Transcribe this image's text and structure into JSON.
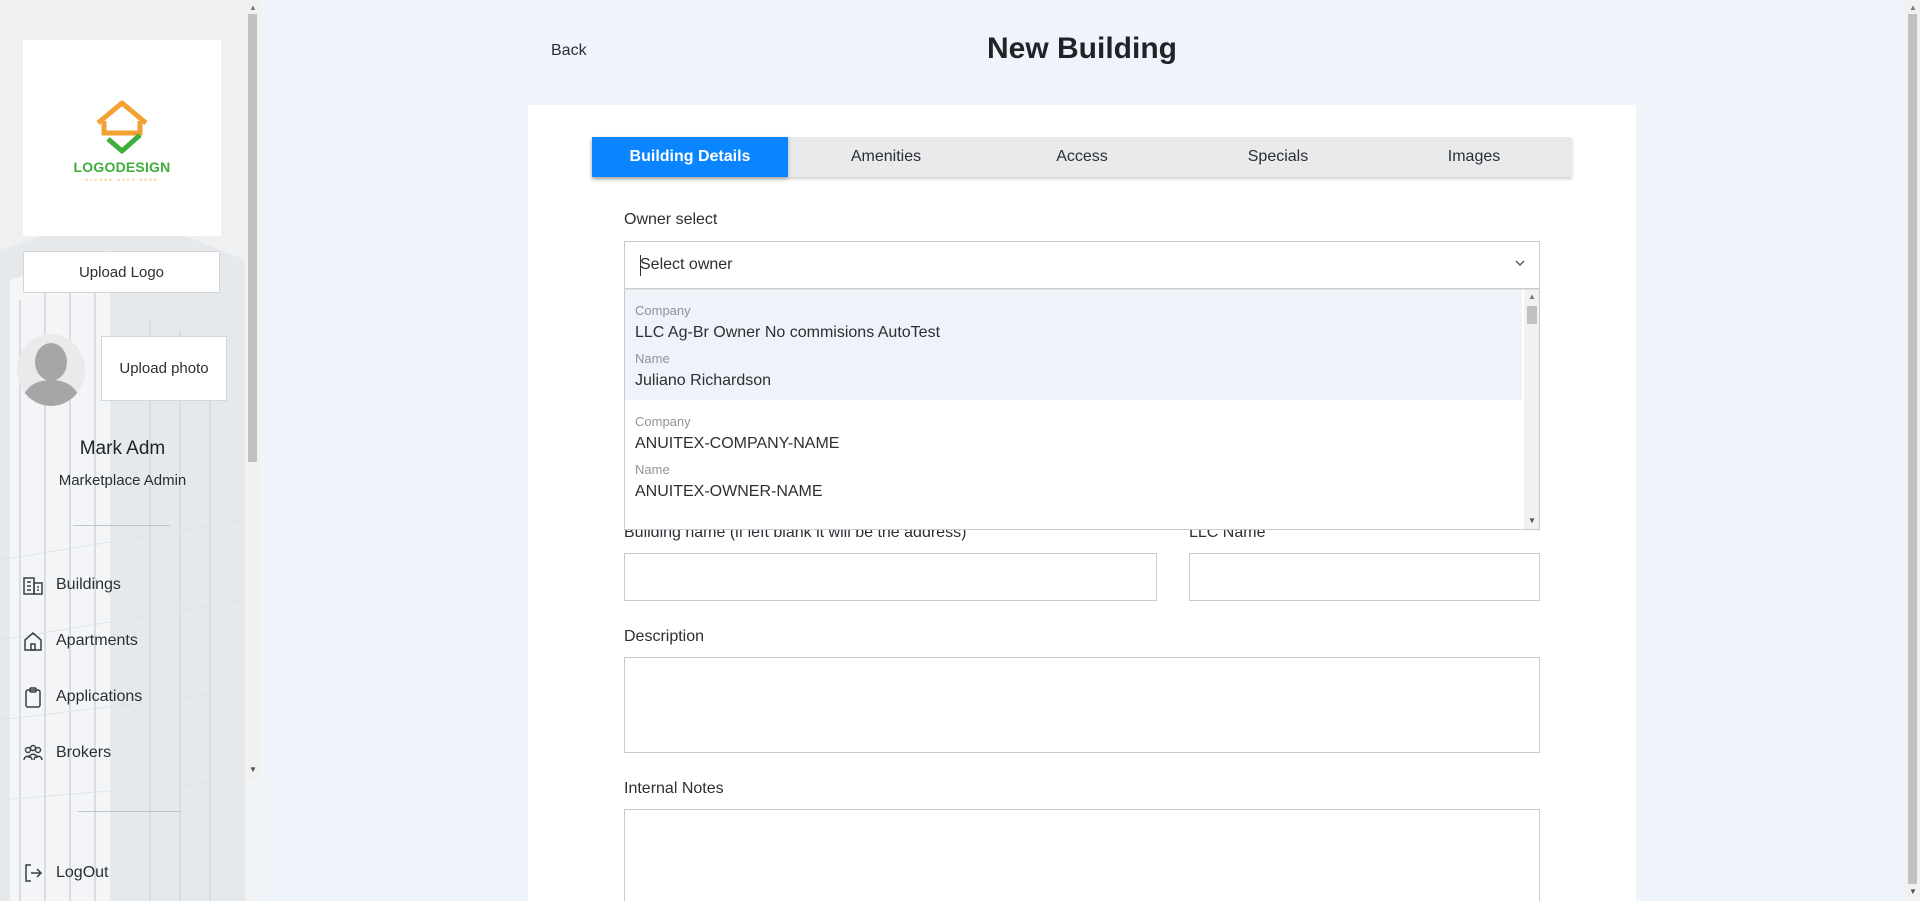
{
  "sidebar": {
    "logo": {
      "word": "LOGODESIGN",
      "slogan": "SLOGAN GOES HERE"
    },
    "upload_logo_label": "Upload Logo",
    "upload_photo_label": "Upload photo",
    "user": {
      "name": "Mark Adm",
      "role": "Marketplace Admin"
    },
    "nav": [
      {
        "label": "Buildings",
        "icon": "buildings-icon"
      },
      {
        "label": "Apartments",
        "icon": "home-icon"
      },
      {
        "label": "Applications",
        "icon": "clipboard-icon"
      },
      {
        "label": "Brokers",
        "icon": "people-icon"
      }
    ],
    "logout_label": "LogOut"
  },
  "header": {
    "back_label": "Back",
    "title": "New Building"
  },
  "tabs": [
    {
      "label": "Building Details",
      "active": true
    },
    {
      "label": "Amenities",
      "active": false
    },
    {
      "label": "Access",
      "active": false
    },
    {
      "label": "Specials",
      "active": false
    },
    {
      "label": "Images",
      "active": false
    }
  ],
  "form": {
    "owner_select": {
      "label": "Owner select",
      "placeholder": "Select owner",
      "options": [
        {
          "company_label": "Company",
          "company": "LLC Ag-Br Owner No commisions AutoTest",
          "name_label": "Name",
          "name": "Juliano Richardson"
        },
        {
          "company_label": "Company",
          "company": "ANUITEX-COMPANY-NAME",
          "name_label": "Name",
          "name": "ANUITEX-OWNER-NAME"
        }
      ]
    },
    "building_name_label": "Building name (if left blank it will be the address)",
    "llc_name_label": "LLC Name",
    "description_label": "Description",
    "internal_notes_label": "Internal Notes"
  },
  "colors": {
    "accent": "#0a84ff",
    "logo_orange": "#f2a233",
    "logo_green": "#3fae3b"
  }
}
